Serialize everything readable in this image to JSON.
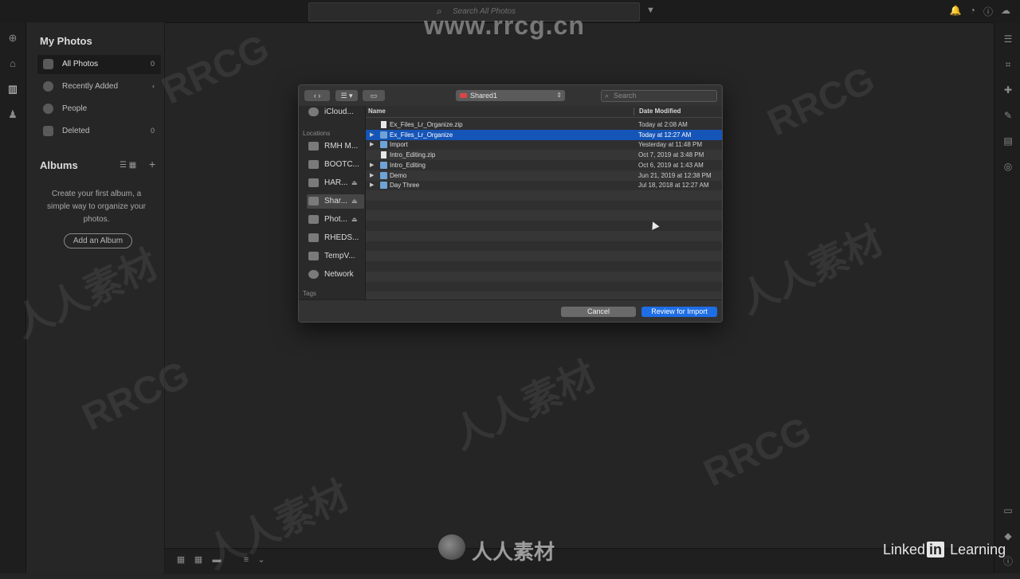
{
  "topbar": {
    "search_placeholder": "Search All Photos"
  },
  "watermark": {
    "top_text": "www.rrcg.cn",
    "repeat_text": "RRCG",
    "cjk_text": "人人素材",
    "bottom_text": "人人素材"
  },
  "left_panel": {
    "my_photos_title": "My Photos",
    "items": [
      {
        "label": "All Photos",
        "count": "0"
      },
      {
        "label": "Recently Added",
        "count": "‹"
      },
      {
        "label": "People",
        "count": ""
      },
      {
        "label": "Deleted",
        "count": "0"
      }
    ],
    "albums_title": "Albums",
    "album_hint": "Create your first album, a simple way to organize your photos.",
    "add_album_label": "Add an Album"
  },
  "dialog": {
    "location": "Shared1",
    "search_placeholder": "Search",
    "sidebar": {
      "icloud": "iCloud...",
      "locations_header": "Locations",
      "items": [
        {
          "label": "RMH M...",
          "eject": ""
        },
        {
          "label": "BOOTC...",
          "eject": ""
        },
        {
          "label": "HAR...",
          "eject": "⏏"
        },
        {
          "label": "Shar...",
          "eject": "⏏"
        },
        {
          "label": "Phot...",
          "eject": "⏏"
        },
        {
          "label": "RHEDS...",
          "eject": ""
        },
        {
          "label": "TempV...",
          "eject": ""
        },
        {
          "label": "Network",
          "eject": ""
        }
      ],
      "tags_header": "Tags"
    },
    "columns": {
      "name": "Name",
      "date": "Date Modified"
    },
    "files": [
      {
        "name": "Ex_Files_Lr_Organize.zip",
        "date": "Today at 2:08 AM",
        "type": "doc"
      },
      {
        "name": "Ex_Files_Lr_Organize",
        "date": "Today at 12:27 AM",
        "type": "folder"
      },
      {
        "name": "Import",
        "date": "Yesterday at 11:48 PM",
        "type": "folder"
      },
      {
        "name": "Intro_Editing.zip",
        "date": "Oct 7, 2019 at 3:48 PM",
        "type": "doc"
      },
      {
        "name": "Intro_Editing",
        "date": "Oct 6, 2019 at 1:43 AM",
        "type": "folder"
      },
      {
        "name": "Demo",
        "date": "Jun 21, 2019 at 12:38 PM",
        "type": "folder"
      },
      {
        "name": "Day Three",
        "date": "Jul 18, 2018 at 12:27 AM",
        "type": "folder"
      }
    ],
    "cancel_label": "Cancel",
    "confirm_label": "Review for Import"
  },
  "branding": {
    "linkedin_prefix": "Linked",
    "linkedin_in": "in",
    "linkedin_suffix": "Learning"
  }
}
